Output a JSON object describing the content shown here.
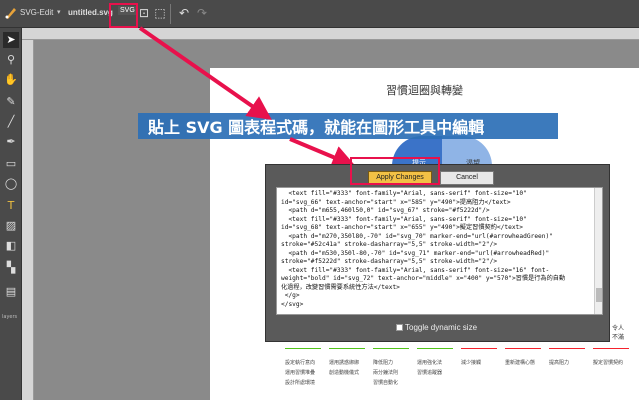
{
  "app": {
    "name": "SVG-Edit",
    "arrow": "▾",
    "doc_title": "untitled.svg",
    "svg_button": "SVG"
  },
  "toolbar": {
    "icons": [
      "tool-icon-1",
      "tool-icon-2",
      "tool-icon-3",
      "undo-icon",
      "redo-icon"
    ]
  },
  "left_tools": {
    "layers_label": "layers"
  },
  "canvas": {
    "chart_title": "習慣迴圈與轉變",
    "circle_left_label": "提示",
    "circle_right_label": "渴望",
    "side_text_1": "令人",
    "side_text_2": "不滿",
    "legend": [
      {
        "line1": "設定執行意向",
        "line2": "運用習慣堆疊",
        "line3": "設計所處環境"
      },
      {
        "line1": "運用誘惑綁綁",
        "line2": "創造動機儀式",
        "line3": ""
      },
      {
        "line1": "降低阻力",
        "line2": "兩分鐘法則",
        "line3": "習慣自動化"
      },
      {
        "line1": "運用強化法",
        "line2": "習慣追蹤器",
        "line3": ""
      },
      {
        "line1": "減少接觸",
        "line2": "",
        "line3": ""
      },
      {
        "line1": "重新建構心態",
        "line2": "",
        "line3": ""
      },
      {
        "line1": "提高阻力",
        "line2": "",
        "line3": ""
      },
      {
        "line1": "擬定習慣契約",
        "line2": "",
        "line3": ""
      }
    ],
    "legend_colors": [
      "#52c41a",
      "#52c41a",
      "#52c41a",
      "#52c41a",
      "#f5222d",
      "#f5222d",
      "#f5222d",
      "#f5222d"
    ]
  },
  "annotation": {
    "banner_text": "貼上 SVG 圖表程式碼，就能在圖形工具中編輯",
    "banner_color": "#2b6fb6",
    "highlight_color": "#e8114c"
  },
  "dialog": {
    "apply_label": "Apply Changes",
    "cancel_label": "Cancel",
    "toggle_label": "Toggle dynamic size",
    "code": "  <text fill=\"#333\" font-family=\"Arial, sans-serif\" font-size=\"10\"\nid=\"svg_66\" text-anchor=\"start\" x=\"585\" y=\"490\">提高阻力</text>\n  <path d=\"m655,460l50,0\" id=\"svg_67\" stroke=\"#f5222d\"/>\n  <text fill=\"#333\" font-family=\"Arial, sans-serif\" font-size=\"10\"\nid=\"svg_68\" text-anchor=\"start\" x=\"655\" y=\"490\">擬定習慣契約</text>\n  <path d=\"m270,350l80,-70\" id=\"svg_70\" marker-end=\"url(#arrowheadGreen)\"\nstroke=\"#52c41a\" stroke-dasharray=\"5,5\" stroke-width=\"2\"/>\n  <path d=\"m530,350l-80,-70\" id=\"svg_71\" marker-end=\"url(#arrowheadRed)\"\nstroke=\"#f5222d\" stroke-dasharray=\"5,5\" stroke-width=\"2\"/>\n  <text fill=\"#333\" font-family=\"Arial, sans-serif\" font-size=\"16\" font-\nweight=\"bold\" id=\"svg_72\" text-anchor=\"middle\" x=\"400\" y=\"570\">習慣是行為的自動\n化過程，改變習慣需要系統性方法</text>\n </g>\n</svg>"
  }
}
